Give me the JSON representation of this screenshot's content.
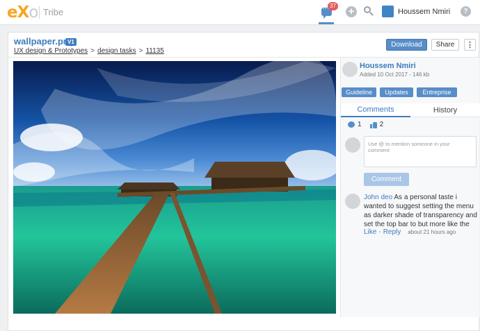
{
  "topbar": {
    "logo_part1": "eX",
    "logo_part2": "o",
    "brand": "Tribe",
    "notification_count": "37",
    "user_name": "Houssem Nmiri",
    "help_glyph": "?"
  },
  "document": {
    "title": "wallpaper.png",
    "version": "V1",
    "breadcrumb": [
      "UX design & Prototypes",
      "design tasks",
      "11135"
    ],
    "breadcrumb_separator": ">",
    "actions": {
      "download": "Download",
      "share": "Share",
      "more": "⋮"
    }
  },
  "panel": {
    "owner_name": "Houssem Nmiri",
    "owner_meta": "Added 10 Oct 2017 - 146 kb",
    "tags": [
      "Guideline",
      "Updates",
      "Entreprise"
    ],
    "tabs": [
      "Comments",
      "History"
    ],
    "comment_count": "1",
    "like_count": "2",
    "comment_placeholder": "Use @ to mention someone in your comment",
    "comment_button": "Comment",
    "comment": {
      "author": "John deo",
      "text": "As a personal taste i wanted to suggest setting the menu as darker shade of transparency and set the top bar to but more like the",
      "like": "Like",
      "separator": "-",
      "reply": "Reply",
      "time": "about 21 hours ago"
    }
  },
  "colors": {
    "accent": "#578dc9",
    "link": "#3d7bbf",
    "logo": "#f5a623",
    "badge": "#e45a5a",
    "muted_button": "#a9c6e7"
  },
  "icons": {
    "chat": "chat-icon",
    "add": "plus-icon",
    "search": "search-icon",
    "help": "help-icon",
    "comments": "comment-bubble-icon",
    "likes": "thumbs-up-icon",
    "more": "more-vertical-icon"
  }
}
